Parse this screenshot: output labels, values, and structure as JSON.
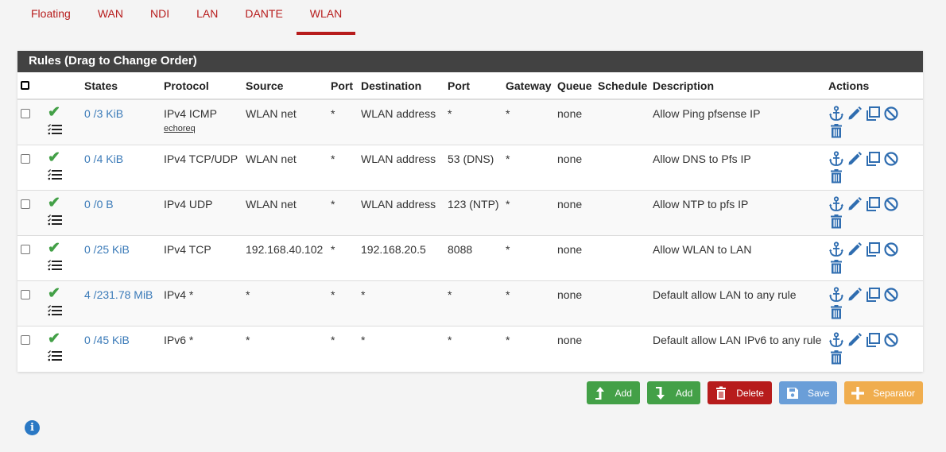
{
  "tabs": [
    {
      "label": "Floating",
      "active": false
    },
    {
      "label": "WAN",
      "active": false
    },
    {
      "label": "NDI",
      "active": false
    },
    {
      "label": "LAN",
      "active": false
    },
    {
      "label": "DANTE",
      "active": false
    },
    {
      "label": "WLAN",
      "active": true
    }
  ],
  "panel": {
    "title": "Rules (Drag to Change Order)"
  },
  "columns": [
    "",
    "",
    "States",
    "Protocol",
    "Source",
    "Port",
    "Destination",
    "Port",
    "Gateway",
    "Queue",
    "Schedule",
    "Description",
    "Actions"
  ],
  "rules": [
    {
      "states": "0 /3 KiB",
      "protocol": "IPv4 ICMP",
      "protocol_sub": "echoreq",
      "source": "WLAN net",
      "source_port": "*",
      "destination": "WLAN address",
      "dest_port": "*",
      "gateway": "*",
      "queue": "none",
      "schedule": "",
      "description": "Allow Ping pfsense IP"
    },
    {
      "states": "0 /4 KiB",
      "protocol": "IPv4 TCP/UDP",
      "protocol_sub": "",
      "source": "WLAN net",
      "source_port": "*",
      "destination": "WLAN address",
      "dest_port": "53 (DNS)",
      "gateway": "*",
      "queue": "none",
      "schedule": "",
      "description": "Allow DNS to Pfs IP"
    },
    {
      "states": "0 /0 B",
      "protocol": "IPv4 UDP",
      "protocol_sub": "",
      "source": "WLAN net",
      "source_port": "*",
      "destination": "WLAN address",
      "dest_port": "123 (NTP)",
      "gateway": "*",
      "queue": "none",
      "schedule": "",
      "description": "Allow NTP to pfs IP"
    },
    {
      "states": "0 /25 KiB",
      "protocol": "IPv4 TCP",
      "protocol_sub": "",
      "source": "192.168.40.102",
      "source_port": "*",
      "destination": "192.168.20.5",
      "dest_port": "8088",
      "gateway": "*",
      "queue": "none",
      "schedule": "",
      "description": "Allow WLAN to LAN"
    },
    {
      "states": "4 /231.78 MiB",
      "protocol": "IPv4 *",
      "protocol_sub": "",
      "source": "*",
      "source_port": "*",
      "destination": "*",
      "dest_port": "*",
      "gateway": "*",
      "queue": "none",
      "schedule": "",
      "description": "Default allow LAN to any rule"
    },
    {
      "states": "0 /45 KiB",
      "protocol": "IPv6 *",
      "protocol_sub": "",
      "source": "*",
      "source_port": "*",
      "destination": "*",
      "dest_port": "*",
      "gateway": "*",
      "queue": "none",
      "schedule": "",
      "description": "Default allow LAN IPv6 to any rule"
    }
  ],
  "buttons": {
    "add_top": "Add",
    "add_bottom": "Add",
    "delete": "Delete",
    "save": "Save",
    "separator": "Separator"
  },
  "info_icon": "i",
  "colors": {
    "accent": "#b71c1c",
    "header_bg": "#424242",
    "link": "#3a7ab8",
    "success": "#43a047",
    "save": "#6a9ed8",
    "separator": "#f0ad4e"
  }
}
